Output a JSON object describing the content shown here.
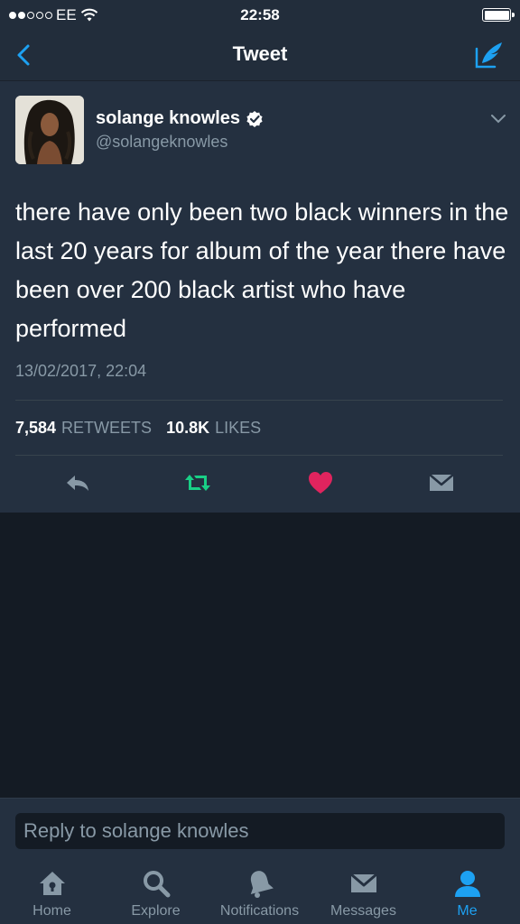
{
  "status_bar": {
    "carrier": "EE",
    "time": "22:58"
  },
  "nav": {
    "title": "Tweet"
  },
  "tweet": {
    "author_name": "solange knowles",
    "author_handle": "@solangeknowles",
    "verified": true,
    "text": "there have only been two black winners in the last 20 years for album of the year there have been over 200 black artist who have performed",
    "timestamp": "13/02/2017, 22:04",
    "retweets_count": "7,584",
    "retweets_label": "RETWEETS",
    "likes_count": "10.8K",
    "likes_label": "LIKES"
  },
  "reply": {
    "placeholder": "Reply to solange knowles"
  },
  "tabs": [
    {
      "label": "Home",
      "icon": "home-icon"
    },
    {
      "label": "Explore",
      "icon": "search-icon"
    },
    {
      "label": "Notifications",
      "icon": "bell-icon"
    },
    {
      "label": "Messages",
      "icon": "envelope-icon"
    },
    {
      "label": "Me",
      "icon": "person-icon",
      "active": true
    }
  ],
  "colors": {
    "accent": "#1da1f2",
    "retweet_green": "#19cf86",
    "like_red": "#e0245e",
    "muted": "#8899a6"
  }
}
